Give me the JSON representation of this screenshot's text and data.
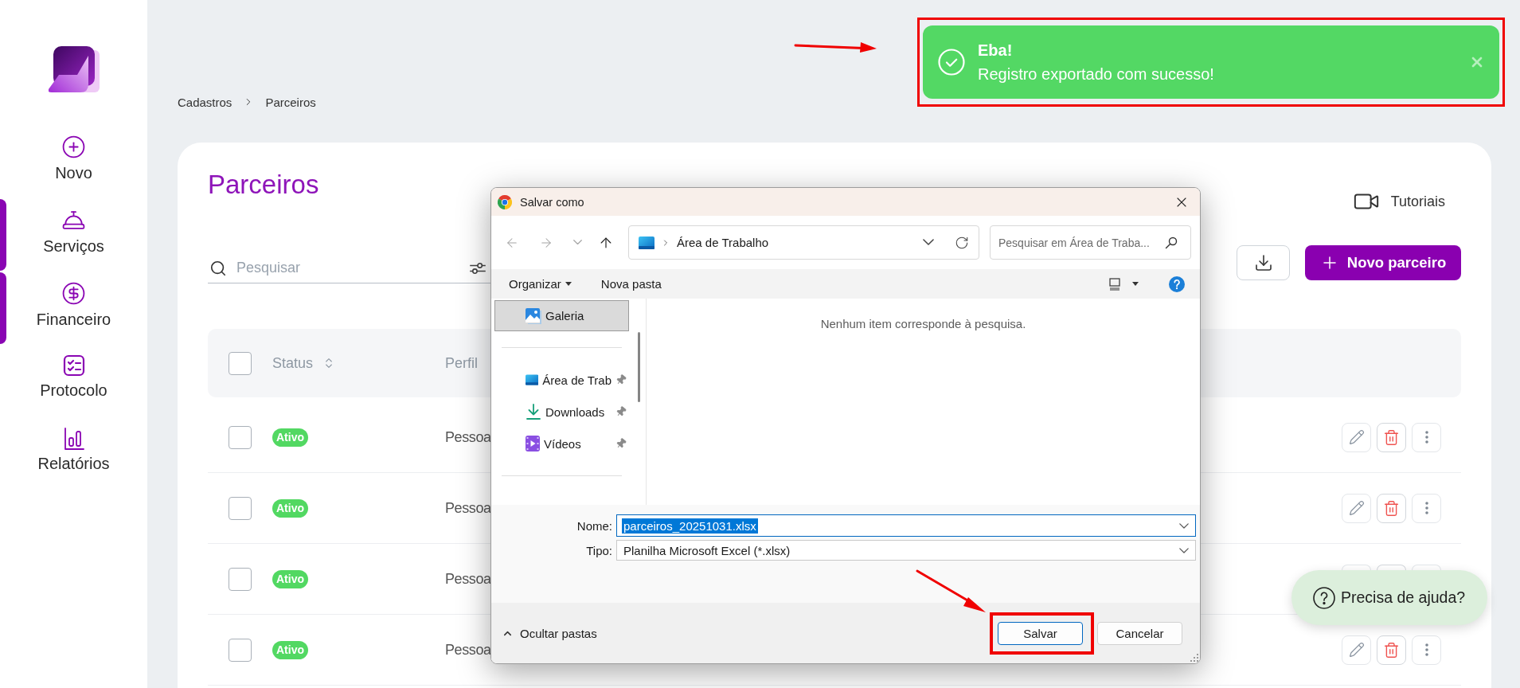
{
  "sidebar": {
    "items": [
      {
        "label": "Novo",
        "selected": false
      },
      {
        "label": "Serviços",
        "selected": true
      },
      {
        "label": "Financeiro",
        "selected": true
      },
      {
        "label": "Protocolo",
        "selected": false
      },
      {
        "label": "Relatórios",
        "selected": false
      }
    ]
  },
  "toast": {
    "title": "Eba!",
    "message": "Registro exportado com sucesso!",
    "highlighted": true
  },
  "breadcrumb": [
    {
      "label": "Cadastros"
    },
    {
      "label": "Parceiros"
    }
  ],
  "page": {
    "title": "Parceiros",
    "tutorials": "Tutoriais",
    "search": {
      "placeholder": "Pesquisar"
    },
    "new_button": "Novo parceiro"
  },
  "table": {
    "all_checked": false,
    "columns": [
      {
        "label": "Status"
      },
      {
        "label": "Perfil"
      }
    ],
    "rows": [
      {
        "checked": false,
        "status": "Ativo",
        "profile": "Pessoa",
        "actions_covered": false
      },
      {
        "checked": false,
        "status": "Ativo",
        "profile": "Pessoa",
        "actions_covered": false
      },
      {
        "checked": false,
        "status": "Ativo",
        "profile": "Pessoa",
        "actions_covered": true
      },
      {
        "checked": false,
        "status": "Ativo",
        "profile": "Pessoa",
        "actions_covered": false
      }
    ]
  },
  "dialog": {
    "title": "Salvar como",
    "nav_buttons": [
      {
        "disabled": true
      },
      {
        "disabled": true
      },
      {
        "disabled": true
      },
      {
        "disabled": false
      }
    ],
    "address": "Área de Trabalho",
    "search_placeholder": "Pesquisar em Área de Traba...",
    "toolbar": [
      {
        "label": "Organizar",
        "kind": "menu"
      },
      {
        "label": "Nova pasta",
        "kind": "button"
      }
    ],
    "nav_groups": [
      {
        "items": [
          {
            "label": "Galeria",
            "selected": true,
            "pinned": false
          }
        ]
      },
      {
        "items": [
          {
            "label": "Área de Trab",
            "selected": false,
            "pinned": true
          },
          {
            "label": "Downloads",
            "selected": false,
            "pinned": true
          },
          {
            "label": "Vídeos",
            "selected": false,
            "pinned": true
          }
        ]
      }
    ],
    "empty_message": "Nenhum item corresponde à pesquisa.",
    "fields": [
      {
        "label": "Nome:",
        "value": "parceiros_20251031.xlsx",
        "focused": true,
        "text_selected": true
      },
      {
        "label": "Tipo:",
        "value": "Planilha Microsoft Excel (*.xlsx)",
        "focused": false,
        "text_selected": false
      }
    ],
    "toggle": "Ocultar pastas",
    "buttons": [
      {
        "label": "Salvar",
        "primary": true,
        "highlighted": true
      },
      {
        "label": "Cancelar",
        "primary": false,
        "highlighted": false
      }
    ]
  },
  "help_button": "Precisa de ajuda?"
}
